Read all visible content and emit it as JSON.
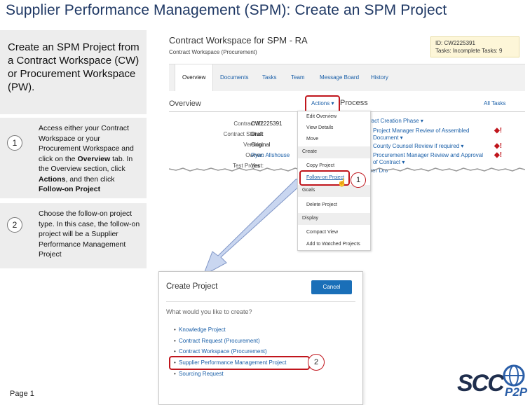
{
  "title": "Supplier Performance Management (SPM): Create an SPM Project",
  "intro": "Create an SPM Project from a Contract Workspace (CW) or Procurement Workspace (PW).",
  "steps": [
    {
      "number": "1",
      "text_a": "Access either your Contract Workspace or your Procurement Workspace and click on the ",
      "bold_a": "Overview",
      "text_b": " tab.  In the Overview section, click ",
      "bold_b": "Actions",
      "text_c": ", and then click ",
      "bold_c": "Follow-on Project"
    },
    {
      "number": "2",
      "text": "Choose the follow-on project type.  In this case, the follow-on project will be a Supplier Performance Management Project"
    }
  ],
  "page_label": "Page 1",
  "workspace": {
    "title": "Contract Workspace for SPM - RA",
    "subtitle": "Contract Workspace (Procurement)",
    "id_line": "ID: CW2225391",
    "tasks_line": "Tasks: Incomplete Tasks: 9",
    "tabs": [
      "Overview",
      "Documents",
      "Tasks",
      "Team",
      "Message Board",
      "History"
    ],
    "overview_heading": "Overview",
    "actions_label": "Actions ▾",
    "process_heading": "Process",
    "all_tasks": "All Tasks",
    "fields": [
      {
        "label": "Contract ID:",
        "value": "CW2225391"
      },
      {
        "label": "Contract Status:",
        "value": "Draft"
      },
      {
        "label": "Version:",
        "value": "Original"
      },
      {
        "label": "Owner:",
        "value": "Ryan Allshouse"
      },
      {
        "label": "Test Project:",
        "value": "Yes"
      }
    ],
    "process_items": [
      "ract Creation Phase ▾",
      "Project Manager Review of Assembled Document ▾",
      "County Counsel Review if required ▾",
      "Procurement Manager Review and Approval of Contract ▾",
      "ver Dro"
    ]
  },
  "actions_menu": {
    "items_top": [
      "Edit Overview",
      "View Details",
      "Move"
    ],
    "section_create": "Create",
    "items_create": [
      "Copy Project",
      "Follow-on Project"
    ],
    "section_goals": "Goals",
    "items_goals": [
      "Delete Project"
    ],
    "section_display": "Display",
    "items_display": [
      "Compact View",
      "Add to Watched Projects"
    ]
  },
  "callout_1": "1",
  "callout_2": "2",
  "dialog": {
    "title": "Create Project",
    "cancel_label": "Cancel",
    "question": "What would you like to create?",
    "options": [
      "Knowledge Project",
      "Contract Request (Procurement)",
      "Contract Workspace (Procurement)",
      "Supplier Performance Management Project",
      "Sourcing Request"
    ]
  },
  "logo": {
    "main": "SCC",
    "sub": "P2P"
  },
  "colors": {
    "title": "#1f3864",
    "highlight": "#c0151c",
    "link": "#1a5fa8",
    "button": "#1a6fb8",
    "arrow": "#9fb4e0"
  }
}
